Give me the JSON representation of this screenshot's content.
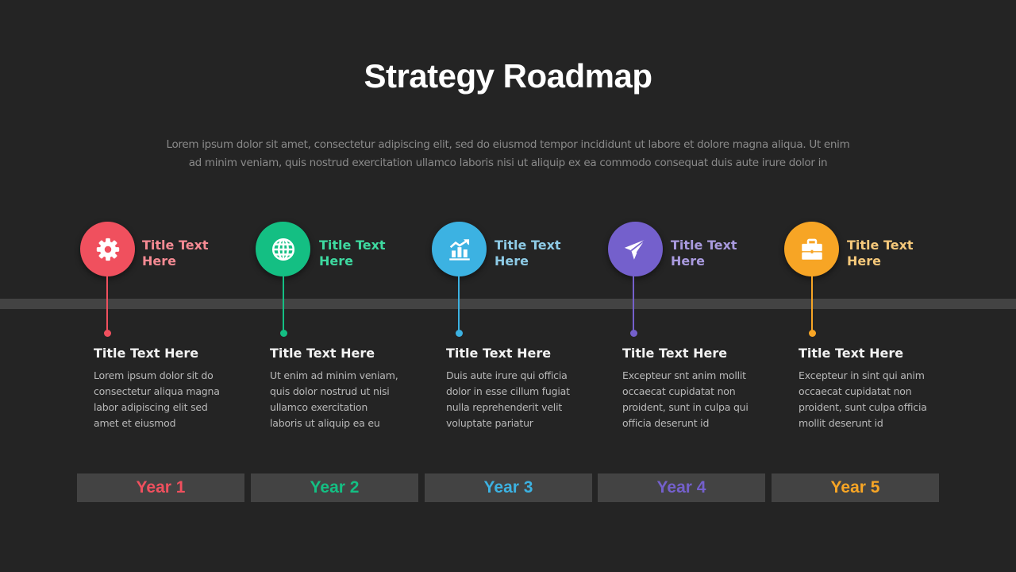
{
  "slide": {
    "title": "Strategy Roadmap",
    "subtitle": "Lorem ipsum dolor sit amet, consectetur adipiscing elit, sed do eiusmod tempor incididunt ut labore et dolore magna aliqua. Ut enim ad minim veniam, quis nostrud exercitation ullamco laboris nisi ut aliquip ex ea commodo consequat duis aute irure dolor in"
  },
  "steps": [
    {
      "icon": "gear-icon",
      "color": "#f0505e",
      "head_color": "#f58a93",
      "head_title": "Title Text Here",
      "card_title": "Title Text Here",
      "card_text": "Lorem ipsum dolor sit do\nconsectetur aliqua magna\nlabor adipiscing elit sed\namet et eiusmod",
      "year": "Year 1"
    },
    {
      "icon": "globe-icon",
      "color": "#14bf83",
      "head_color": "#3ed9a0",
      "head_title": "Title Text Here",
      "card_title": "Title Text Here",
      "card_text": "Ut enim ad minim veniam,\nquis dolor nostrud ut nisi\nullamco exercitation\nlaboris ut aliquip ea eu",
      "year": "Year 2"
    },
    {
      "icon": "growth-chart-icon",
      "color": "#3cb2e2",
      "head_color": "#8ecbe6",
      "head_title": "Title Text Here",
      "card_title": "Title Text Here",
      "card_text": "Duis aute irure qui officia\ndolor in esse cillum fugiat\nnulla reprehenderit velit\nvoluptate pariatur",
      "year": "Year 3"
    },
    {
      "icon": "paper-plane-icon",
      "color": "#7460cc",
      "head_color": "#a99ade",
      "head_title": "Title Text Here",
      "card_title": "Title Text Here",
      "card_text": "Excepteur snt anim mollit\noccaecat cupidatat non\nproident, sunt in culpa qui\nofficia deserunt id",
      "year": "Year 4"
    },
    {
      "icon": "briefcase-icon",
      "color": "#f7a525",
      "head_color": "#f5c87a",
      "head_title": "Title Text Here",
      "card_title": "Title Text Here",
      "card_text": "Excepteur in sint qui anim\noccaecat cupidatat non\nproident, sunt culpa officia\nmollit deserunt id",
      "year": "Year 5"
    }
  ]
}
